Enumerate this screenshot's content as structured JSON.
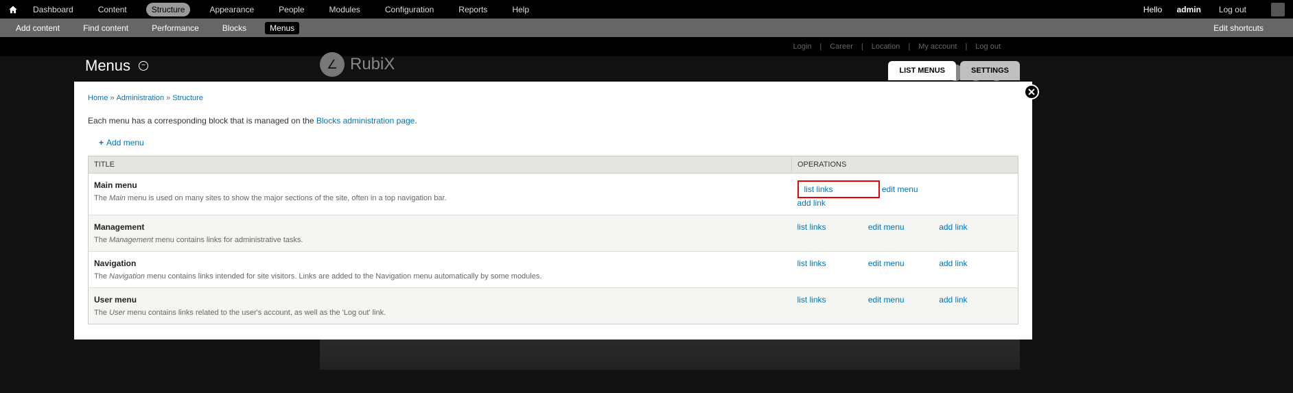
{
  "toolbar": {
    "items": [
      "Dashboard",
      "Content",
      "Structure",
      "Appearance",
      "People",
      "Modules",
      "Configuration",
      "Reports",
      "Help"
    ],
    "active_index": 2,
    "hello": "Hello ",
    "user": "admin",
    "logout": "Log out"
  },
  "shortcuts": {
    "items": [
      "Add content",
      "Find content",
      "Performance",
      "Blocks",
      "Menus"
    ],
    "active_index": 4,
    "edit": "Edit shortcuts"
  },
  "site": {
    "brand": "RubiX",
    "topnav": [
      "Login",
      "Career",
      "Location",
      "My account",
      "Log out"
    ]
  },
  "overlay": {
    "title": "Menus",
    "tabs": [
      {
        "label": "LIST MENUS",
        "active": true
      },
      {
        "label": "SETTINGS",
        "active": false
      }
    ],
    "breadcrumb": [
      {
        "label": "Home"
      },
      {
        "label": "Administration"
      },
      {
        "label": "Structure"
      }
    ],
    "intro_pre": "Each menu has a corresponding block that is managed on the ",
    "intro_link": "Blocks administration page",
    "intro_post": ".",
    "add_menu": "Add menu",
    "th_title": "TITLE",
    "th_ops": "OPERATIONS",
    "op_list": "list links",
    "op_edit": "edit menu",
    "op_add": "add link",
    "rows": [
      {
        "title": "Main menu",
        "desc_pre": "The ",
        "desc_em": "Main",
        "desc_post": " menu is used on many sites to show the major sections of the site, often in a top navigation bar.",
        "highlight": true
      },
      {
        "title": "Management",
        "desc_pre": "The ",
        "desc_em": "Management",
        "desc_post": " menu contains links for administrative tasks.",
        "highlight": false
      },
      {
        "title": "Navigation",
        "desc_pre": "The ",
        "desc_em": "Navigation",
        "desc_post": " menu contains links intended for site visitors. Links are added to the Navigation menu automatically by some modules.",
        "highlight": false
      },
      {
        "title": "User menu",
        "desc_pre": "The ",
        "desc_em": "User",
        "desc_post": " menu contains links related to the user's account, as well as the 'Log out' link.",
        "highlight": false
      }
    ]
  }
}
